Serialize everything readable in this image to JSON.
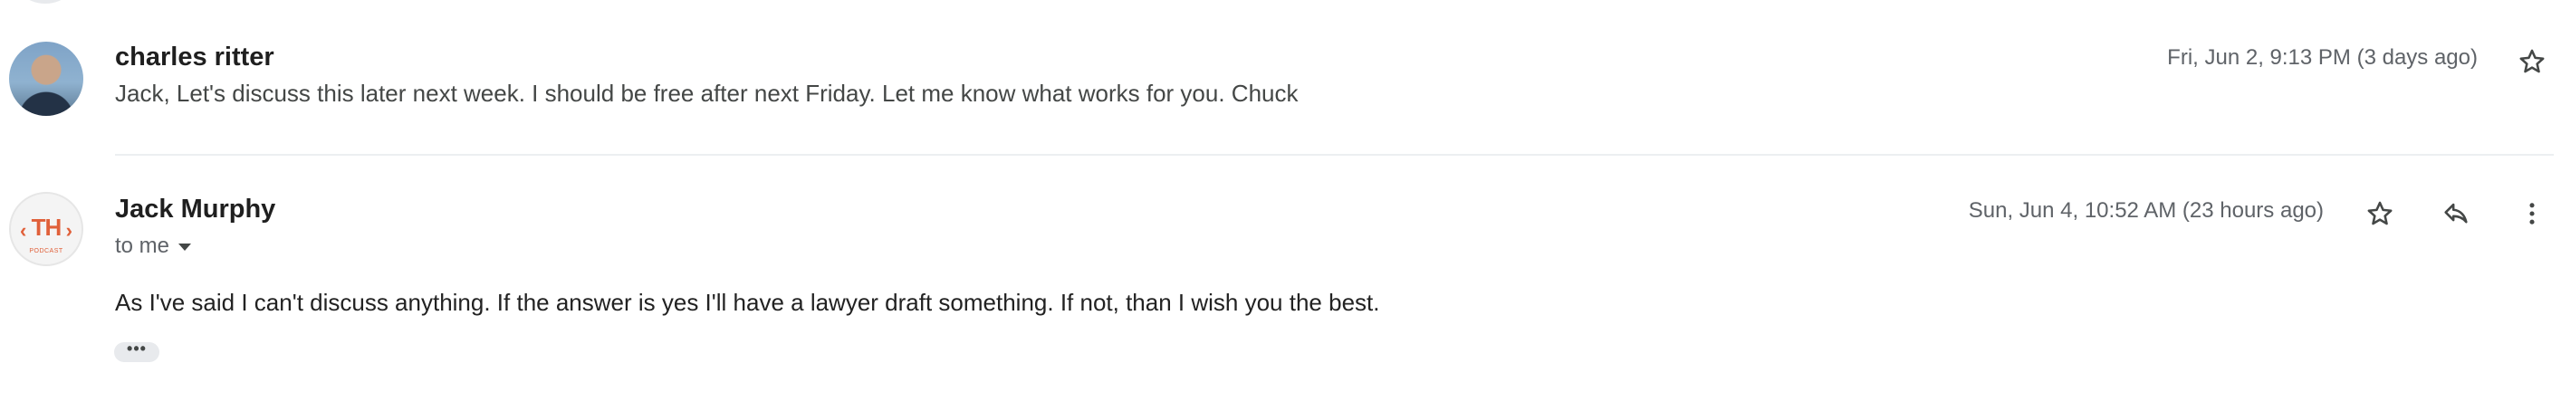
{
  "messages": [
    {
      "sender": "charles ritter",
      "snippet": "Jack, Let's discuss this later next week. I should be free after next Friday. Let me know what works for you. Chuck",
      "date": "Fri, Jun 2, 9:13 PM (3 days ago)",
      "avatar": "profile-photo",
      "icons": [
        "star-icon"
      ]
    },
    {
      "sender": "Jack Murphy",
      "recipient": "to me",
      "body": "As I've said I can't discuss anything. If the answer is yes I'll have a lawyer draft something. If not, than I wish you the best.",
      "date": "Sun, Jun 4, 10:52 AM (23 hours ago)",
      "avatar": "logo",
      "avatar_logo": {
        "text": "TH",
        "subtext": "PODCAST",
        "color": "#e0603a"
      },
      "trimmed_content_label": "•••",
      "icons": [
        "star-icon",
        "reply-icon",
        "more-vert-icon"
      ]
    }
  ],
  "colors": {
    "sender": "#1f1f1f",
    "secondary_text": "#5f6368",
    "body_text": "#222222",
    "divider": "#eceff1"
  }
}
